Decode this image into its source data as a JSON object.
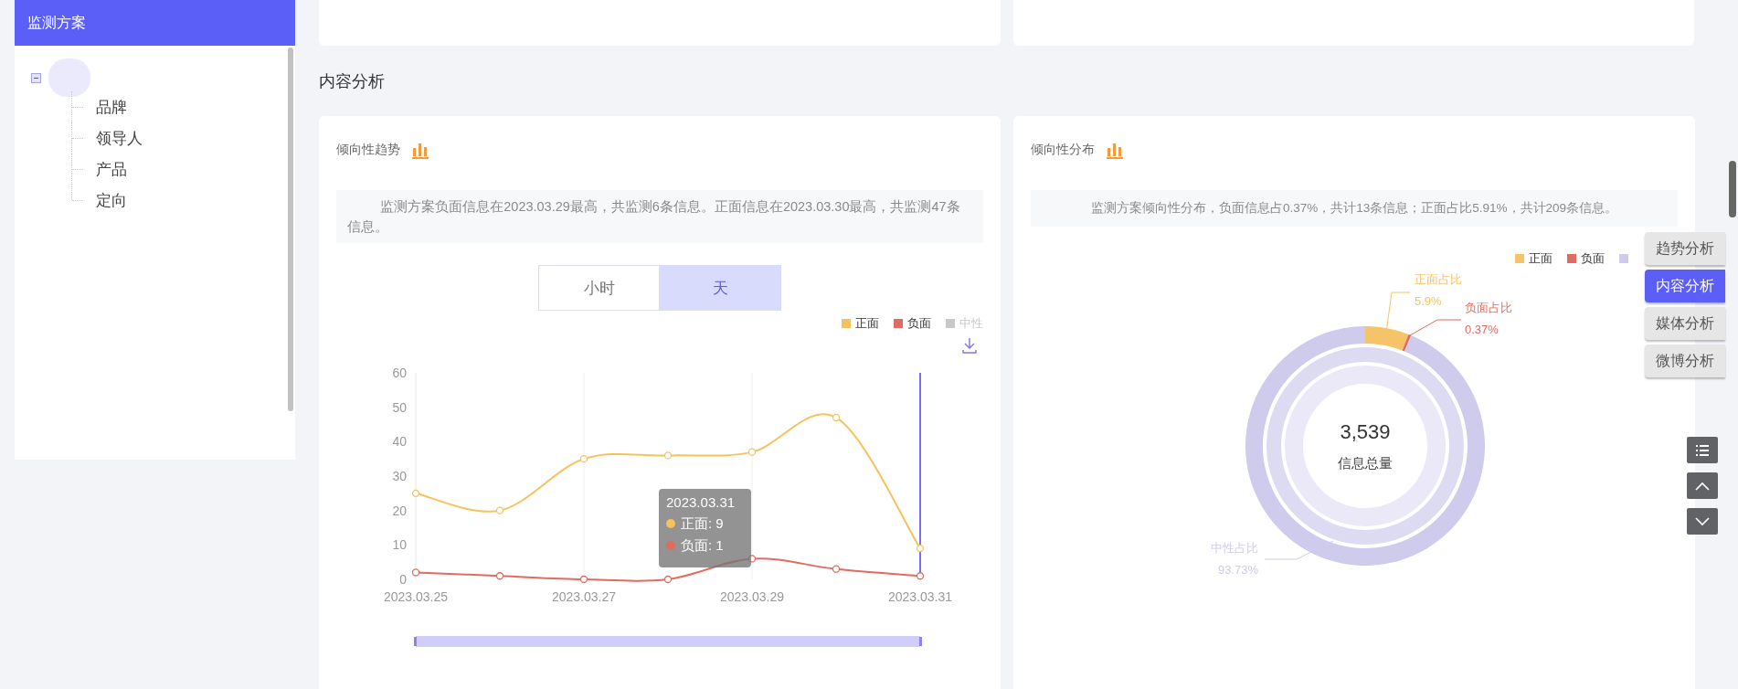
{
  "sidebar": {
    "title": "监测方案",
    "tree": [
      {
        "expanded": true,
        "children": [
          {
            "label": "品牌"
          },
          {
            "label": "领导人"
          },
          {
            "label": "产品"
          },
          {
            "label": "定向"
          }
        ]
      }
    ]
  },
  "section_title": "内容分析",
  "trend_card": {
    "title": "倾向性趋势",
    "summary": "监测方案负面信息在2023.03.29最高，共监测6条信息。正面信息在2023.03.30最高，共监测47条信息。",
    "tabs": [
      {
        "label": "小时",
        "selected": false
      },
      {
        "label": "天",
        "selected": true
      }
    ],
    "legend": [
      {
        "label": "正面",
        "color": "#f5c25e",
        "on": true
      },
      {
        "label": "负面",
        "color": "#e06b62",
        "on": true
      },
      {
        "label": "中性",
        "color": "#c8c8c8",
        "on": false
      }
    ],
    "chart_data": {
      "type": "line",
      "categories": [
        "2023.03.25",
        null,
        "2023.03.27",
        null,
        "2023.03.29",
        null,
        "2023.03.31"
      ],
      "ylim": [
        0,
        60
      ],
      "yticks": [
        0,
        10,
        20,
        30,
        40,
        50,
        60
      ],
      "series": [
        {
          "color": "#f5c25e",
          "marker": "o",
          "values": [
            25,
            20,
            35,
            36,
            37,
            47,
            9
          ]
        },
        {
          "color": "#e06b62",
          "marker": "o",
          "values": [
            2,
            1,
            0,
            0,
            6,
            3,
            1
          ]
        }
      ],
      "ref_lines": [
        {
          "axis": "x",
          "value": "2023.03.31",
          "color": "#7b6cf0"
        }
      ]
    },
    "tooltip": {
      "title": "2023.03.31",
      "items": [
        {
          "label": "正面: 9",
          "color": "#f5c25e"
        },
        {
          "label": "负面: 1",
          "color": "#e06b62"
        }
      ]
    }
  },
  "distribution_card": {
    "title": "倾向性分布",
    "summary": "监测方案倾向性分布，负面信息占0.37%，共计13条信息；正面占比5.91%，共计209条信息。",
    "legend": [
      {
        "label": "正面",
        "color": "#f5c469"
      },
      {
        "label": "负面",
        "color": "#e06b62"
      },
      {
        "color": "#cfcbec"
      }
    ],
    "chart_data": {
      "type": "donut",
      "categories": [
        "正面占比",
        "负面占比",
        "中性占比"
      ],
      "series": [
        {
          "colors": [
            "#f5c469",
            "#e06b62",
            "#cfcbec"
          ],
          "values": [
            5.9,
            0.37,
            93.73
          ]
        }
      ],
      "value_labels": [
        "5.9%",
        "0.37%",
        "93.73%"
      ]
    },
    "center_value": "3,539",
    "center_label": "信息总量"
  },
  "side_nav": [
    {
      "label": "趋势分析",
      "selected": false
    },
    {
      "label": "内容分析",
      "selected": true
    },
    {
      "label": "媒体分析",
      "selected": false
    },
    {
      "label": "微博分析",
      "selected": false
    }
  ]
}
